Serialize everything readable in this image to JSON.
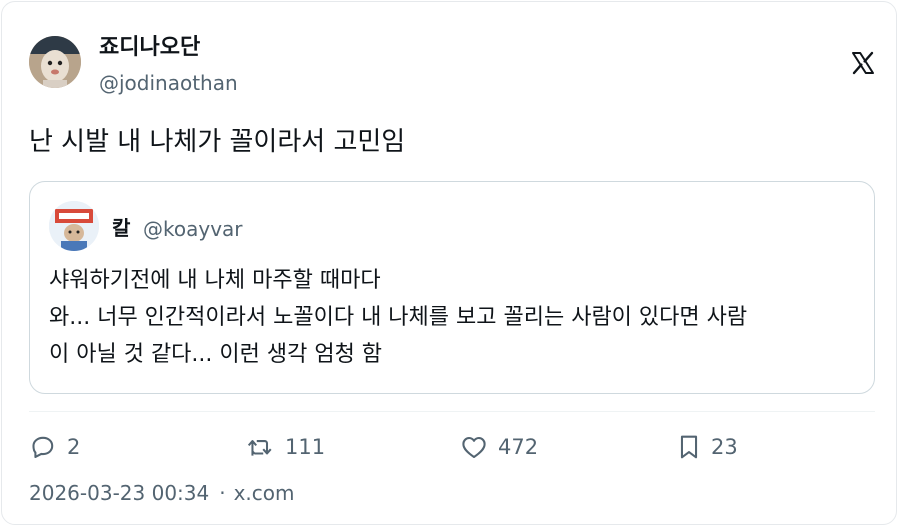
{
  "author": {
    "display_name": "죠디나오단",
    "handle": "@jodinaothan",
    "avatar": "avatar-photo"
  },
  "brand_icon": "x-logo-icon",
  "tweet": {
    "text": "난 시발 내 나체가 꼴이라서 고민임"
  },
  "quoted": {
    "display_name": "칼",
    "handle": "@koayvar",
    "avatar": "avatar-photo",
    "lines": [
      "샤워하기전에 내 나체 마주할 때마다",
      "와... 너무 인간적이라서 노꼴이다 내 나체를 보고 꼴리는 사람이 있다면 사람",
      "이 아닐 것 같다... 이런 생각 엄청 함"
    ]
  },
  "actions": {
    "replies": "2",
    "retweets": "111",
    "likes": "472",
    "bookmarks": "23"
  },
  "meta": {
    "timestamp": "2026-03-23 00:34",
    "separator": "·",
    "source": "x.com"
  },
  "colors": {
    "text_primary": "#0f1419",
    "text_secondary": "#536471",
    "border": "#cfd9de"
  }
}
